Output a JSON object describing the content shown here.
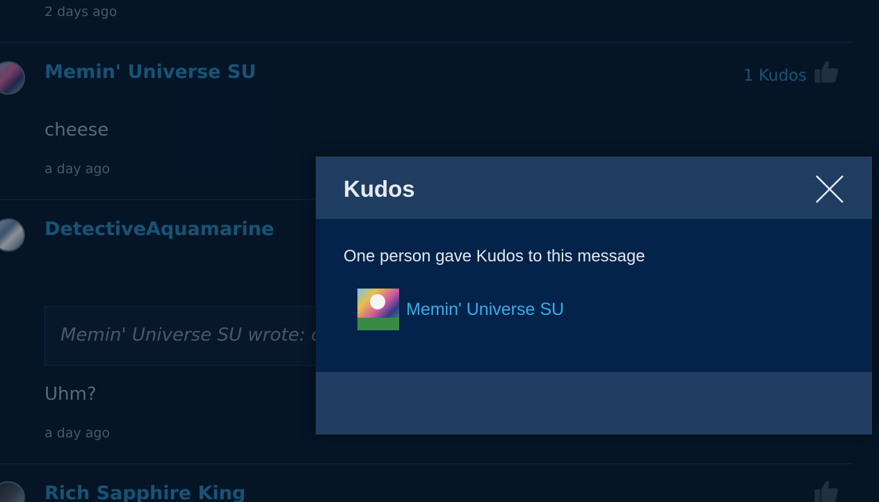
{
  "posts": [
    {
      "time": "2 days ago"
    },
    {
      "author": "Memin' Universe SU",
      "body": "cheese",
      "time": "a day ago",
      "kudos_label": "1 Kudos"
    },
    {
      "author": "DetectiveAquamarine",
      "quote": "Memin' Universe SU wrote: ch",
      "body": "Uhm?",
      "time": "a day ago"
    },
    {
      "author": "Rich Sapphire King"
    }
  ],
  "modal": {
    "title": "Kudos",
    "message": "One person gave Kudos to this message",
    "givers": [
      {
        "name": "Memin' Universe SU",
        "avatar_icon": "user-avatar-image"
      }
    ],
    "close_icon": "close-icon"
  },
  "colors": {
    "page_background": "#0a1f36",
    "author_link": "#2f8fc4",
    "modal_header": "#1f3d61",
    "modal_body": "#04234a",
    "giver_link": "#35aee8"
  }
}
